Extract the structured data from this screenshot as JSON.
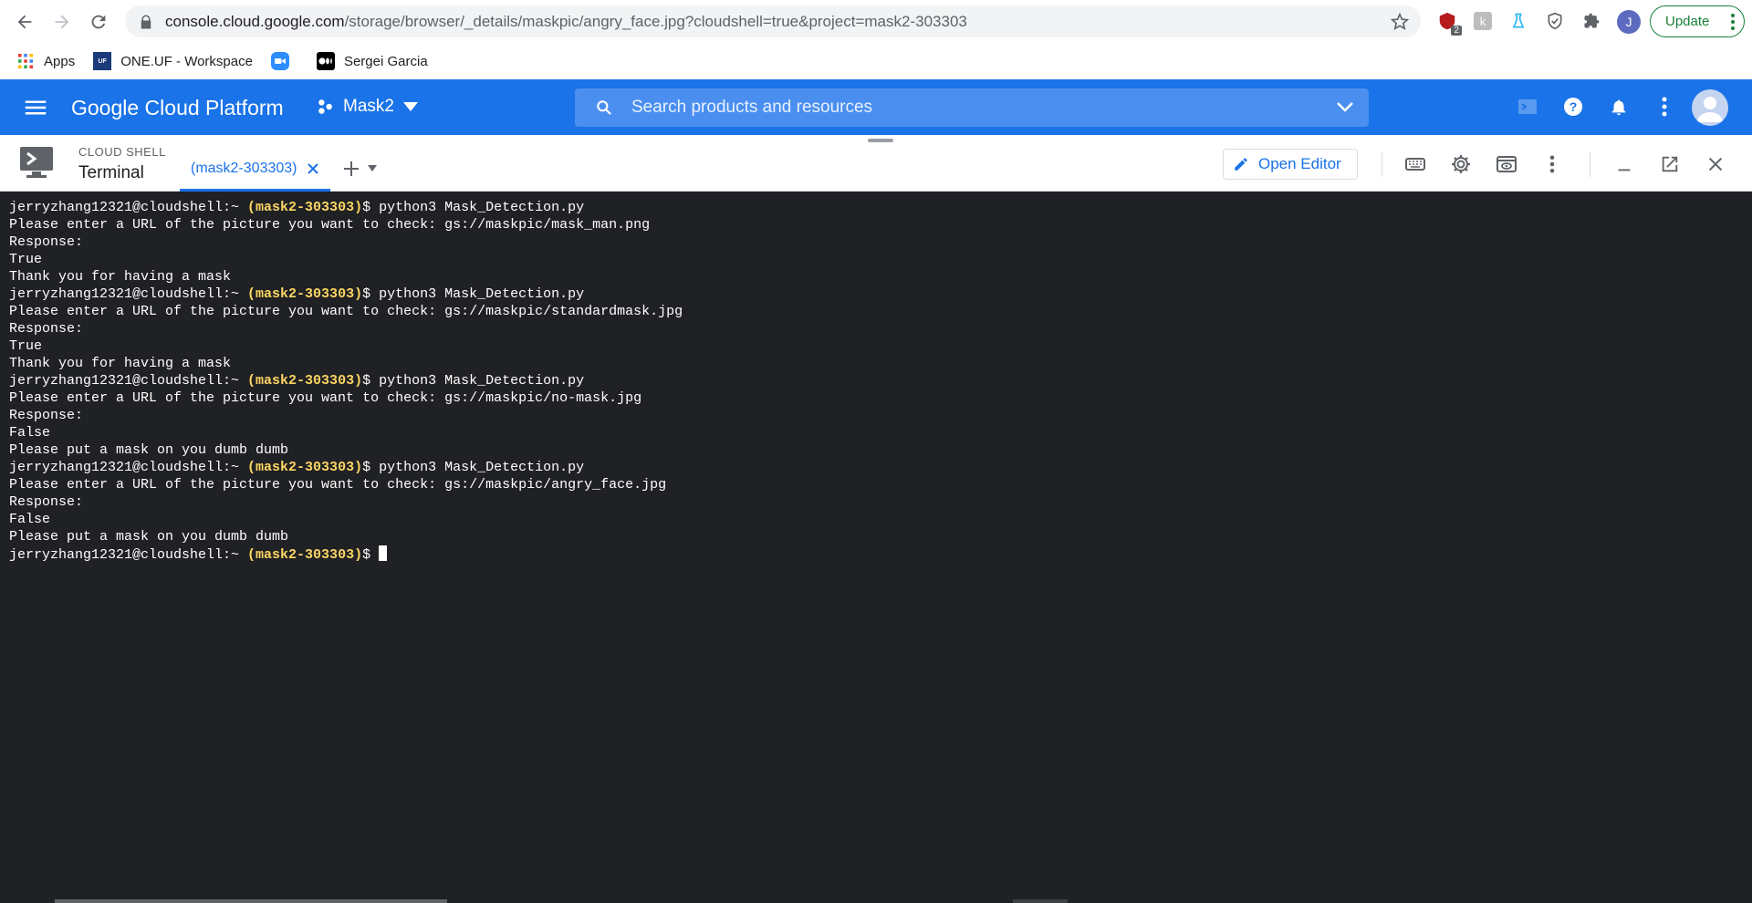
{
  "browser": {
    "url_host": "console.cloud.google.com",
    "url_path": "/storage/browser/_details/maskpic/angry_face.jpg?cloudshell=true&project=mask2-303303",
    "profile_initial": "J",
    "update_label": "Update",
    "extension_badge": "2"
  },
  "bookmarks": [
    {
      "label": "Apps"
    },
    {
      "label": "ONE.UF - Workspace"
    },
    {
      "label": ""
    },
    {
      "label": "Sergei Garcia"
    }
  ],
  "gcp": {
    "title": "Google Cloud Platform",
    "project": "Mask2",
    "search_placeholder": "Search products and resources",
    "accent": "#1a73e8"
  },
  "cloud_shell": {
    "caption": "CLOUD SHELL",
    "terminal_label": "Terminal",
    "tab_label": "(mask2-303303)",
    "open_editor_label": "Open Editor"
  },
  "terminal": {
    "prompt_user": "jerryzhang12321@cloudshell:~ ",
    "prompt_project": "(mask2-303303)",
    "prompt_suffix": "$ ",
    "project_color": "#fdd663",
    "lines": [
      {
        "type": "prompt",
        "cmd": "python3 Mask_Detection.py"
      },
      {
        "type": "out",
        "text": "Please enter a URL of the picture you want to check: gs://maskpic/mask_man.png"
      },
      {
        "type": "out",
        "text": "Response:"
      },
      {
        "type": "out",
        "text": "True"
      },
      {
        "type": "out",
        "text": "Thank you for having a mask"
      },
      {
        "type": "prompt",
        "cmd": "python3 Mask_Detection.py"
      },
      {
        "type": "out",
        "text": "Please enter a URL of the picture you want to check: gs://maskpic/standardmask.jpg"
      },
      {
        "type": "out",
        "text": "Response:"
      },
      {
        "type": "out",
        "text": "True"
      },
      {
        "type": "out",
        "text": "Thank you for having a mask"
      },
      {
        "type": "prompt",
        "cmd": "python3 Mask_Detection.py"
      },
      {
        "type": "out",
        "text": "Please enter a URL of the picture you want to check: gs://maskpic/no-mask.jpg"
      },
      {
        "type": "out",
        "text": "Response:"
      },
      {
        "type": "out",
        "text": "False"
      },
      {
        "type": "out",
        "text": "Please put a mask on you dumb dumb"
      },
      {
        "type": "prompt",
        "cmd": "python3 Mask_Detection.py"
      },
      {
        "type": "out",
        "text": "Please enter a URL of the picture you want to check: gs://maskpic/angry_face.jpg"
      },
      {
        "type": "out",
        "text": "Response:"
      },
      {
        "type": "out",
        "text": "False"
      },
      {
        "type": "out",
        "text": "Please put a mask on you dumb dumb"
      },
      {
        "type": "prompt",
        "cmd": "",
        "cursor": true
      }
    ]
  }
}
